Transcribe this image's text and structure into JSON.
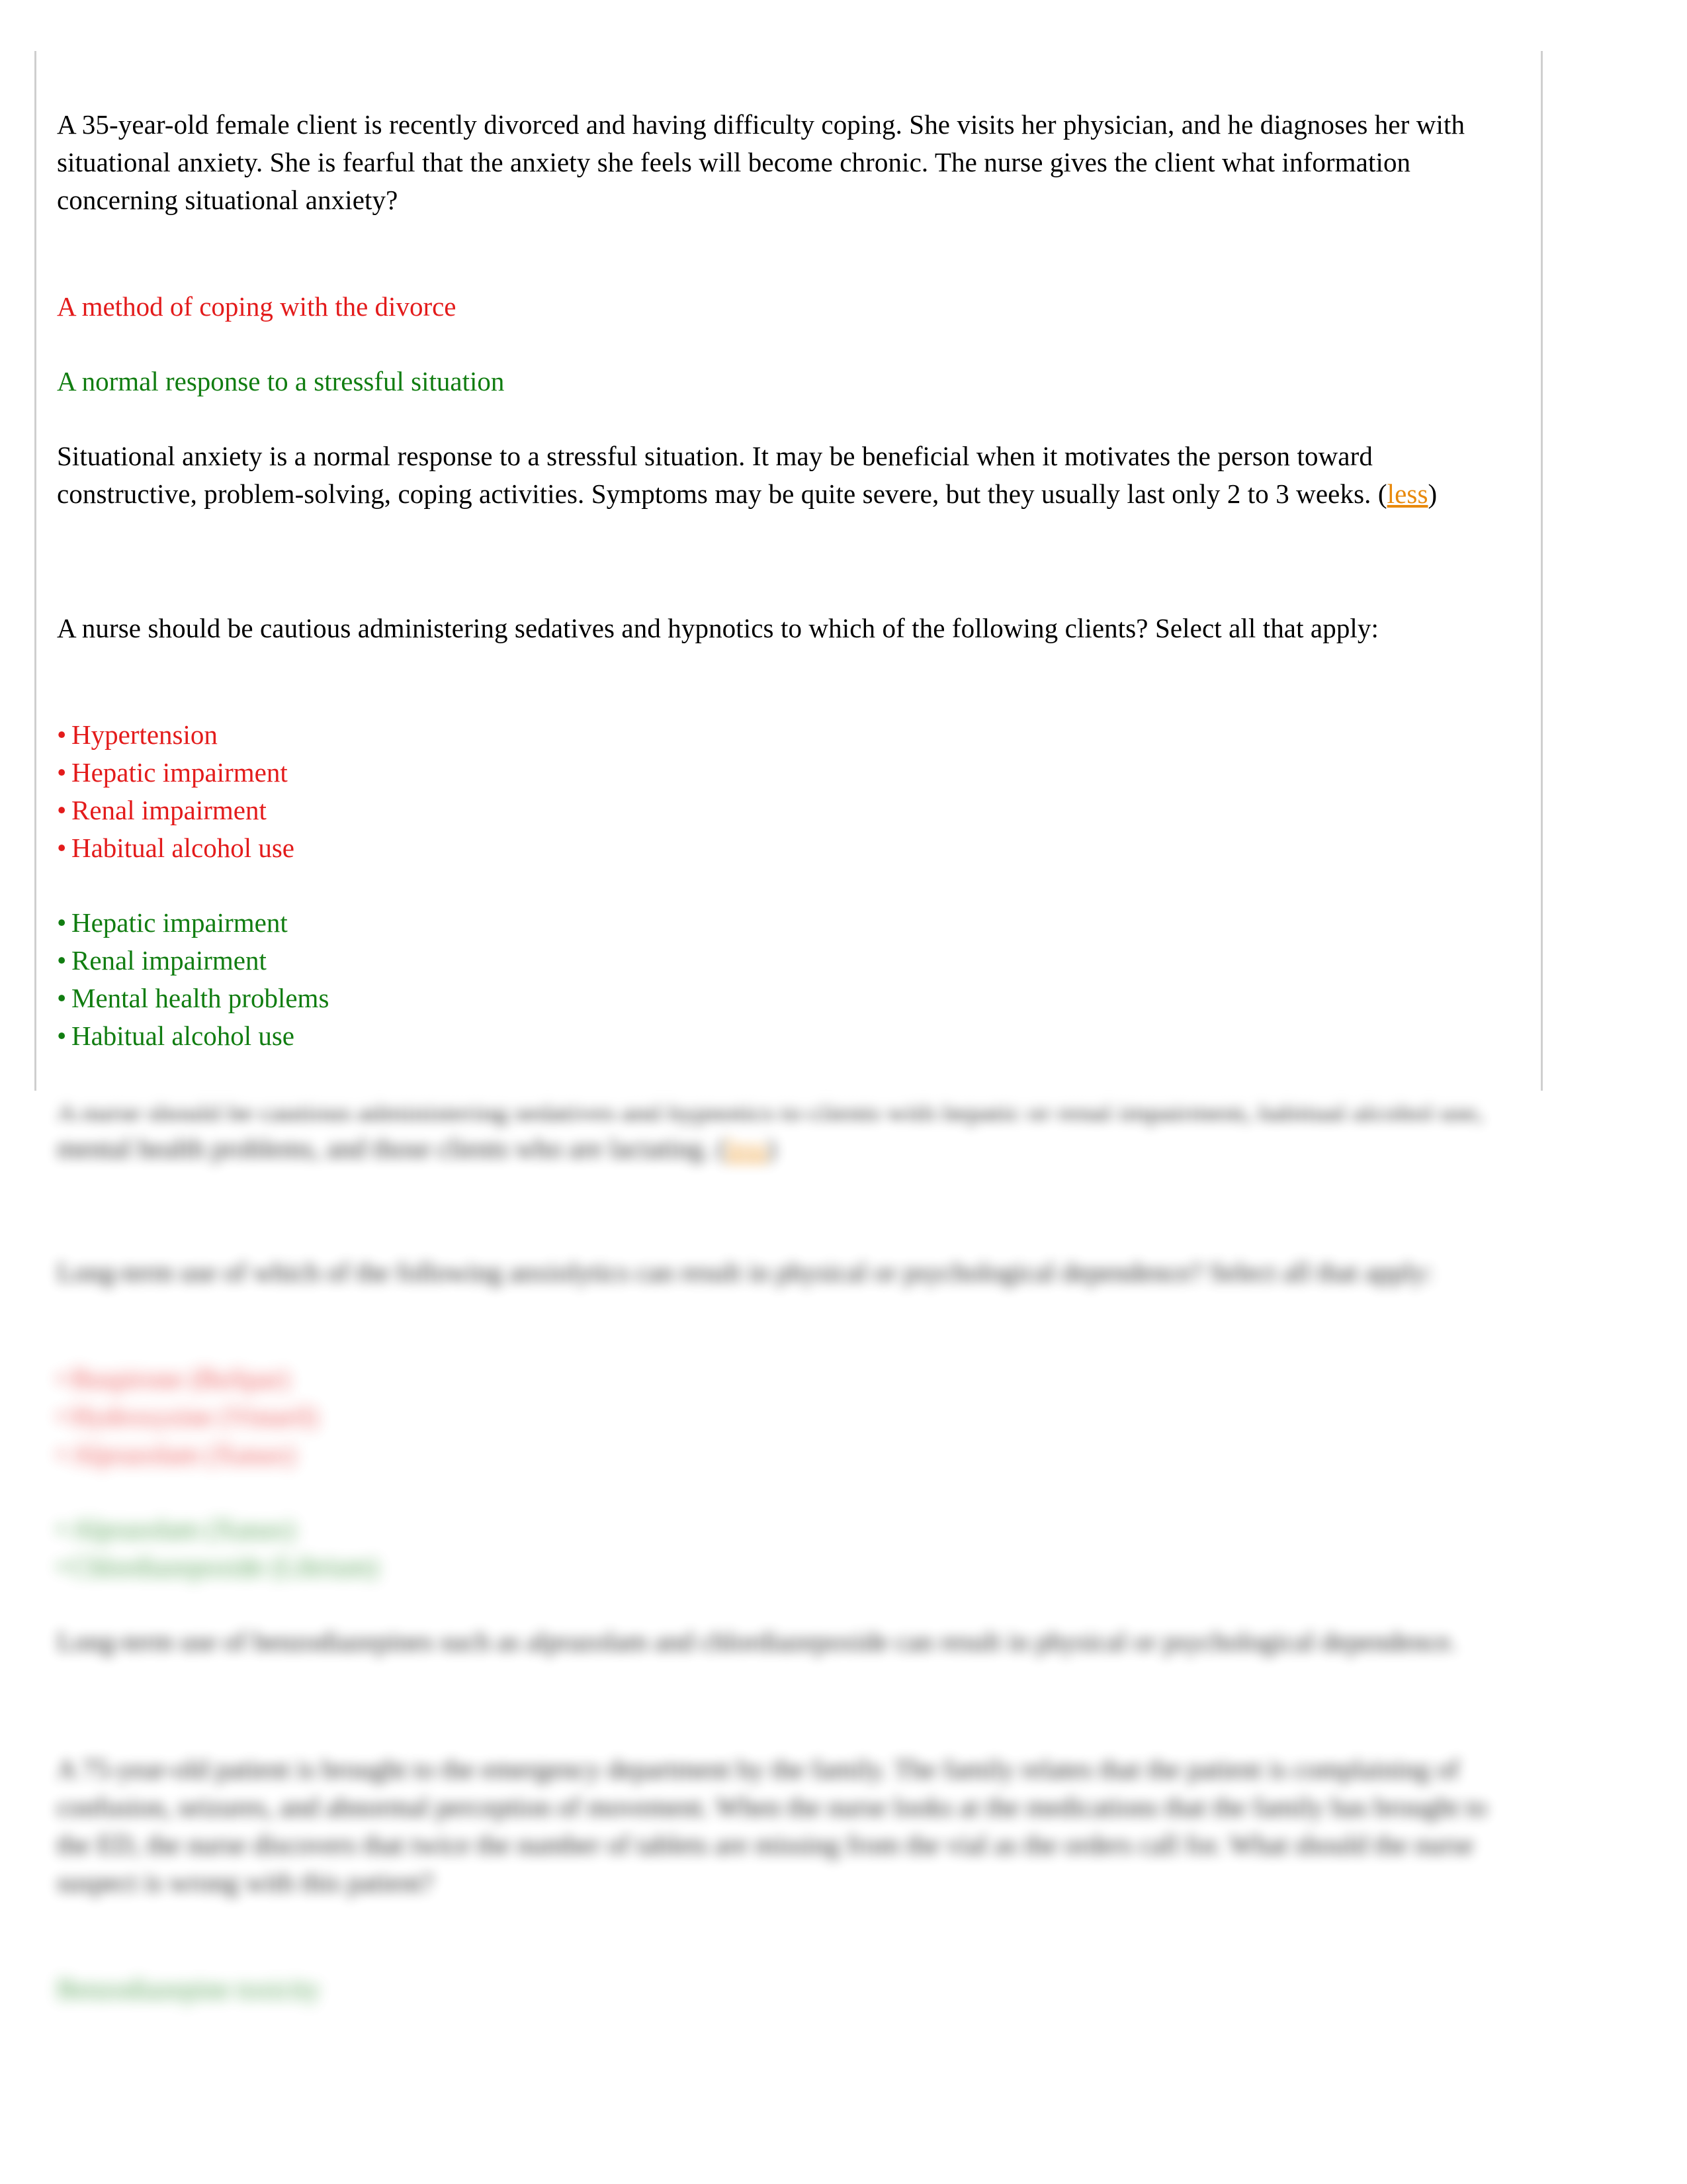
{
  "document": {
    "type": "nursing-exam-study-sheet",
    "colors": {
      "correct": "#117d11",
      "incorrect": "#e31b1b",
      "link": "#e8890c",
      "body_text": "#000000",
      "rule": "#cfcfcf"
    }
  },
  "questions": [
    {
      "id": "q1",
      "stem": "A 35-year-old female client is recently divorced and having difficulty coping. She visits her physician, and he diagnoses her with situational anxiety. She is fearful that the anxiety she feels will become chronic. The nurse gives the client what information concerning situational anxiety?",
      "selected_answer": "A method of coping with the divorce",
      "correct_answer": "A normal response to a stressful situation",
      "rationale_pre": "Situational anxiety is a normal response to a stressful situation. It may be beneficial when it motivates the person toward constructive, problem-solving, coping activities. Symptoms may be quite severe, but they usually last only 2 to 3 weeks. (",
      "rationale_link": "less",
      "rationale_post": ")",
      "blurred": false
    },
    {
      "id": "q2",
      "stem": "A nurse should be cautious administering sedatives and hypnotics to which of the following clients? Select all that apply:",
      "selected_choices": [
        "Hypertension",
        "Hepatic impairment",
        "Renal impairment",
        "Habitual alcohol use"
      ],
      "correct_choices": [
        "Hepatic impairment",
        "Renal impairment",
        "Mental health problems",
        "Habitual alcohol use"
      ],
      "rationale_pre": "A nurse should be cautious administering sedatives and hypnotics to clients with hepatic or renal impairment, habitual alcohol use, mental health problems, and those clients who are lactating. (",
      "rationale_link": "less",
      "rationale_post": ")",
      "blurred_rationale": true
    },
    {
      "id": "q3",
      "stem": "Long-term use of which of the following anxiolytics can result in physical or psychological dependence? Select all that apply:",
      "selected_choices": [
        "Buspirone (BuSpar)",
        "Hydroxyzine (Vistaril)",
        "Alprazolam (Xanax)"
      ],
      "correct_choices": [
        "Alprazolam (Xanax)",
        "Chlordiazepoxide (Librium)"
      ],
      "rationale": "Long-term use of benzodiazepines such as alprazolam and chlordiazepoxide can result in physical or psychological dependence.",
      "blurred": true
    },
    {
      "id": "q4",
      "stem": "A 75-year-old patient is brought to the emergency department by the family. The family relates that the patient is complaining of confusion, seizures, and abnormal perception of movement. When the nurse looks at the medications that the family has brought to the ED, the nurse discovers that twice the number of tablets are missing from the vial as the orders call for. What should the nurse suspect is wrong with this patient?",
      "correct_answer": "Benzodiazepine toxicity",
      "blurred": true
    }
  ]
}
